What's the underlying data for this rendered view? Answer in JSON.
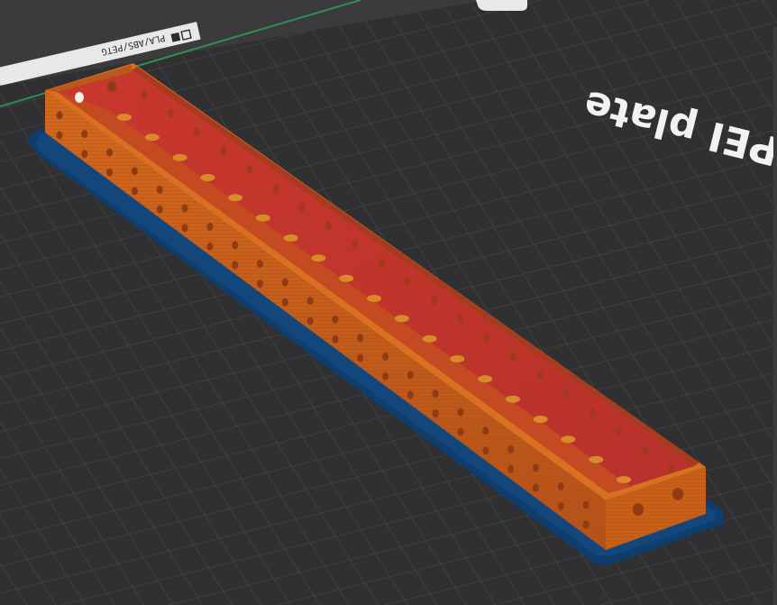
{
  "viewer": {
    "bed_label": "PEI plate",
    "bed_logo": "PLA/ABS/PETG",
    "logo_icon": "bed-logo-icon"
  },
  "colors": {
    "bed": "#303032",
    "grid": "#45464a",
    "brim": "#0d3e6e",
    "part_wall": "#c85e1c",
    "part_inner": "#c23a2e",
    "hole": "#8f3c14",
    "bed_edge": "#2e8f4f",
    "label": "#f2f2f2"
  }
}
